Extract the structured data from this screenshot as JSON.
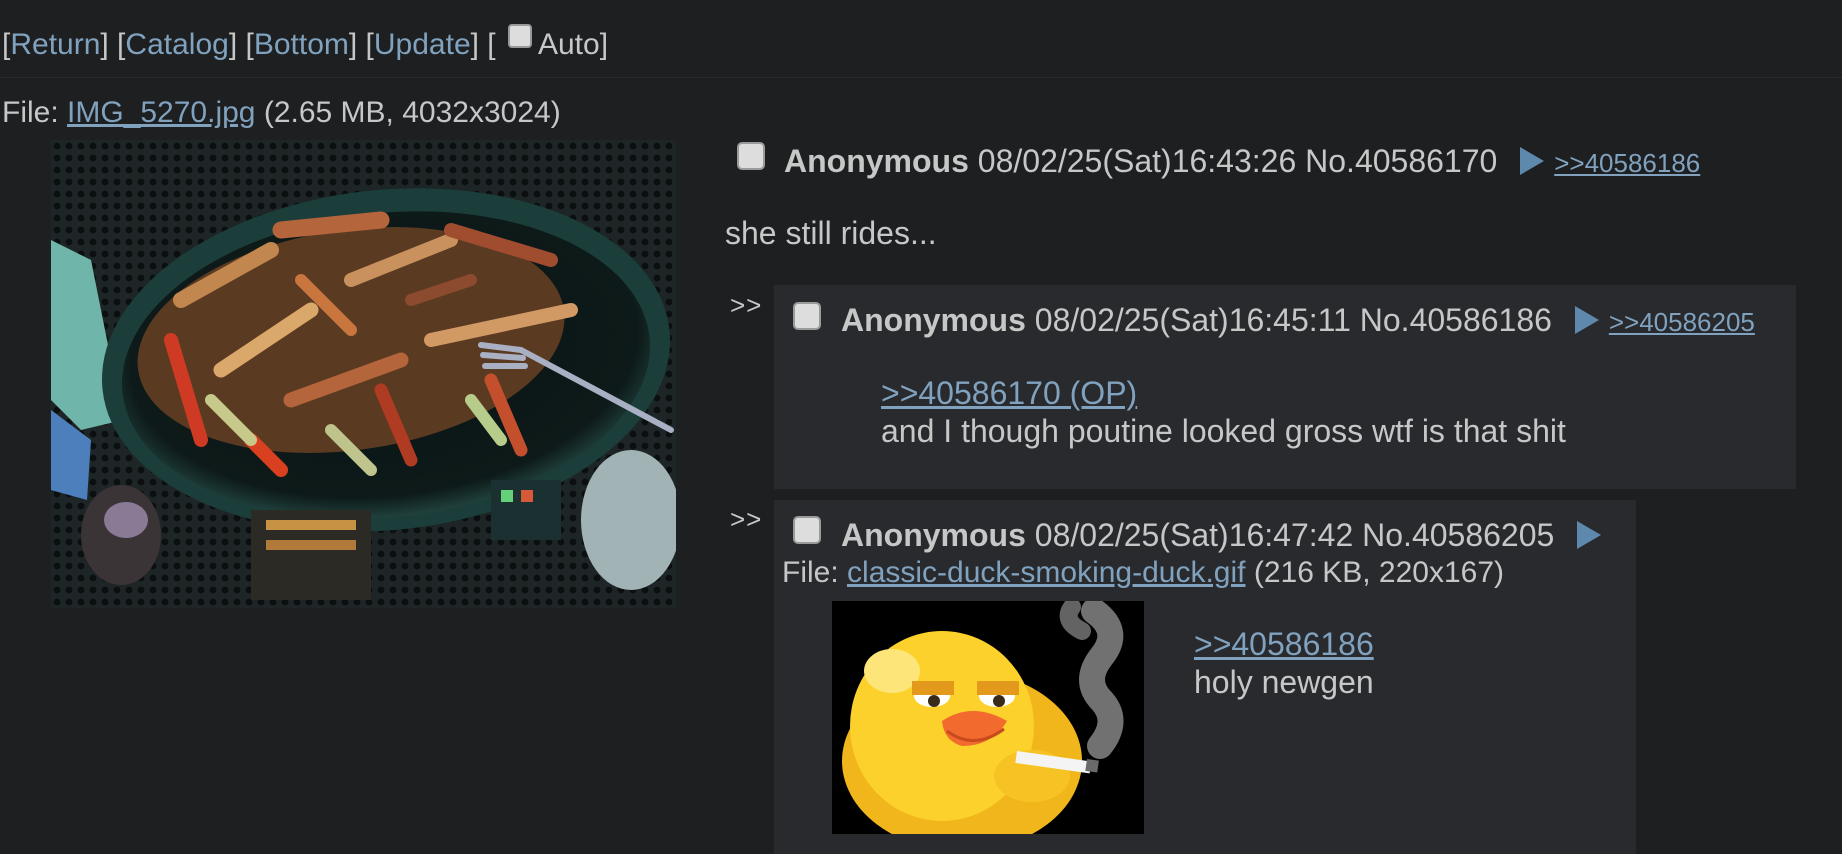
{
  "nav": {
    "links": [
      "Return",
      "Catalog",
      "Bottom",
      "Update"
    ],
    "auto_label": "Auto"
  },
  "op": {
    "file_prefix": "File:",
    "file_name": "IMG_5270.jpg",
    "file_meta": "(2.65 MB, 4032x3024)",
    "name": "Anonymous",
    "datetime": "08/02/25(Sat)16:43:26",
    "number": "No.40586170",
    "backlink": ">>40586186",
    "message": "she still rides..."
  },
  "replies": [
    {
      "side": ">>",
      "name": "Anonymous",
      "datetime": "08/02/25(Sat)16:45:11",
      "number": "No.40586186",
      "backlink": ">>40586205",
      "quote": ">>40586170 (OP)",
      "message": "and I though poutine looked gross wtf is that shit"
    },
    {
      "side": ">>",
      "name": "Anonymous",
      "datetime": "08/02/25(Sat)16:47:42",
      "number": "No.40586205",
      "file_prefix": "File:",
      "file_name": "classic-duck-smoking-duck.gif",
      "file_meta": "(216 KB, 220x167)",
      "quote": ">>40586186",
      "message": "holy newgen"
    }
  ],
  "colors": {
    "background": "#1d1f21",
    "reply_background": "#282a2e",
    "link": "#81a2be",
    "text": "#c5c8c6"
  }
}
